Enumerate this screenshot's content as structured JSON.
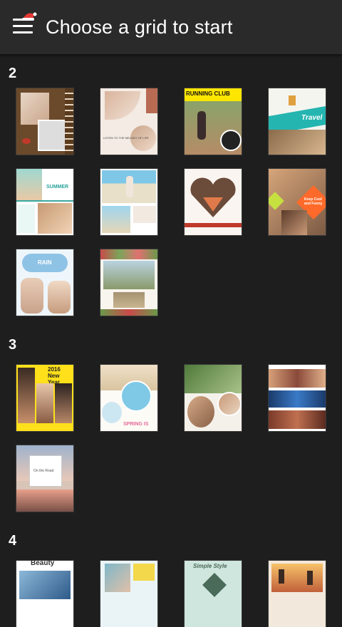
{
  "header": {
    "title": "Choose a grid to start"
  },
  "sections": [
    {
      "label": "2",
      "templates": [
        {
          "name": "template-vintage-frame",
          "caption": ""
        },
        {
          "name": "template-listen-to-melody",
          "caption": "LISTEN TO THE MELODY OF LIFE"
        },
        {
          "name": "template-running-club",
          "caption": "RUNNING CLUB"
        },
        {
          "name": "template-travel",
          "caption": "Travel"
        },
        {
          "name": "template-summer",
          "caption": "SUMMER"
        },
        {
          "name": "template-beach",
          "caption": ""
        },
        {
          "name": "template-heart",
          "caption": ""
        },
        {
          "name": "template-keep-cool",
          "caption": "Keep Cool and Funny"
        },
        {
          "name": "template-rain",
          "caption": "RAIN"
        },
        {
          "name": "template-floral-road",
          "caption": ""
        }
      ]
    },
    {
      "label": "3",
      "templates": [
        {
          "name": "template-2016-new-year",
          "caption": "2016 New Year"
        },
        {
          "name": "template-spring",
          "caption": "SPRING IS"
        },
        {
          "name": "template-plants",
          "caption": ""
        },
        {
          "name": "template-concert",
          "caption": ""
        },
        {
          "name": "template-on-the-road",
          "caption": "On the Road"
        }
      ]
    },
    {
      "label": "4",
      "templates": [
        {
          "name": "template-beauty",
          "caption": "Beauty"
        },
        {
          "name": "template-couple",
          "caption": ""
        },
        {
          "name": "template-simple-style",
          "caption": "Simple Style"
        },
        {
          "name": "template-sunset",
          "caption": ""
        }
      ]
    }
  ]
}
